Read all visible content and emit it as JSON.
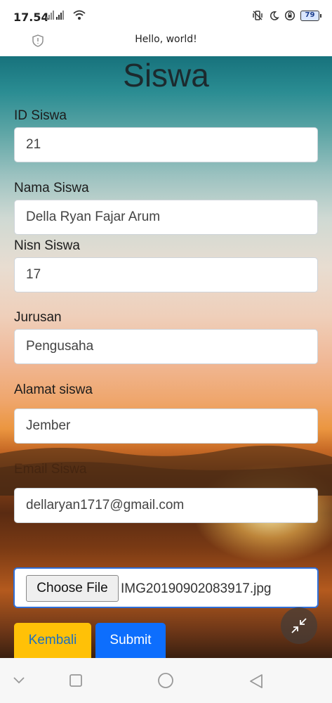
{
  "status_bar": {
    "time": "17.54",
    "battery": "79",
    "icons": [
      "signal-icon",
      "wifi-icon",
      "vibrate-icon",
      "moon-icon",
      "lock-rotation-icon",
      "battery-icon"
    ]
  },
  "app_bar": {
    "title": "Hello, world!",
    "icon": "shield-icon"
  },
  "form": {
    "heading": "Siswa",
    "fields": [
      {
        "label": "ID Siswa",
        "value": "21"
      },
      {
        "label": "Nama Siswa",
        "value": "Della Ryan Fajar Arum"
      },
      {
        "label": "Nisn Siswa",
        "value": "17"
      },
      {
        "label": "Jurusan",
        "value": "Pengusaha"
      },
      {
        "label": "Alamat siswa",
        "value": "Jember"
      },
      {
        "label": "Email Siswa",
        "value": "dellaryan1717@gmail.com"
      }
    ],
    "file_button": "Choose File",
    "file_name": "IMG20190902083917.jpg",
    "back_button": "Kembali",
    "submit_button": "Submit"
  },
  "floating_button": {
    "icon": "minimize-icon"
  },
  "nav_bar": {
    "icons": [
      "back-chevron-icon",
      "recents-square-icon",
      "home-circle-icon",
      "back-triangle-icon"
    ]
  }
}
